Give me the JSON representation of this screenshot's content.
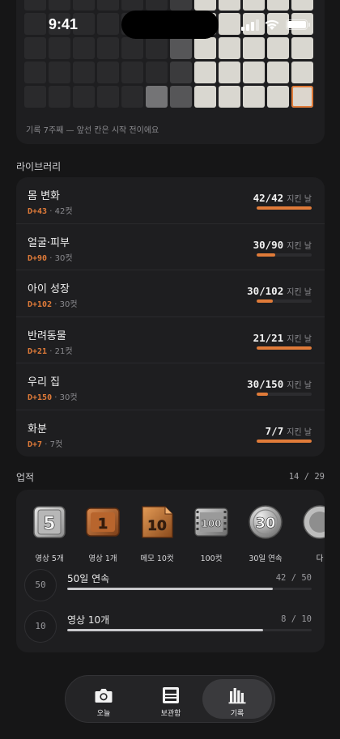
{
  "status_bar": {
    "time": "9:41"
  },
  "grid": {
    "caption": "기록 7주째 — 앞선 칸은 시작 전이에요",
    "rows": [
      [
        "e",
        "e",
        "e",
        "e",
        "e",
        "e",
        "g1",
        "w",
        "w",
        "w",
        "w",
        "w"
      ],
      [
        "e",
        "e",
        "e",
        "e",
        "e",
        "e",
        "g2",
        "w",
        "w",
        "w",
        "w",
        "w"
      ],
      [
        "e",
        "e",
        "e",
        "e",
        "e",
        "e",
        "g2",
        "w",
        "w",
        "w",
        "w",
        "w"
      ],
      [
        "e",
        "e",
        "e",
        "e",
        "e",
        "e",
        "g1",
        "w",
        "w",
        "w",
        "w",
        "w"
      ],
      [
        "e",
        "e",
        "e",
        "e",
        "e",
        "g3",
        "g2",
        "w",
        "w",
        "w",
        "w",
        "today"
      ]
    ]
  },
  "library": {
    "title": "라이브러리",
    "items": [
      {
        "name": "몸 변화",
        "dday": "D+43",
        "shots": "· 42컷",
        "count": "42/42",
        "unit": "지킨 날",
        "progress": 1.0
      },
      {
        "name": "얼굴·피부",
        "dday": "D+90",
        "shots": "· 30컷",
        "count": "30/90",
        "unit": "지킨 날",
        "progress": 0.333
      },
      {
        "name": "아이 성장",
        "dday": "D+102",
        "shots": "· 30컷",
        "count": "30/102",
        "unit": "지킨 날",
        "progress": 0.294
      },
      {
        "name": "반려동물",
        "dday": "D+21",
        "shots": "· 21컷",
        "count": "21/21",
        "unit": "지킨 날",
        "progress": 1.0
      },
      {
        "name": "우리 집",
        "dday": "D+150",
        "shots": "· 30컷",
        "count": "30/150",
        "unit": "지킨 날",
        "progress": 0.2
      },
      {
        "name": "화분",
        "dday": "D+7",
        "shots": "· 7컷",
        "count": "7/7",
        "unit": "지킨 날",
        "progress": 1.0
      }
    ]
  },
  "achievements": {
    "title": "업적",
    "count": "14 / 29",
    "badges": [
      {
        "icon": "silver-5-badge-icon",
        "number": "5",
        "label": "영상 5개"
      },
      {
        "icon": "copper-1-badge-icon",
        "number": "1",
        "label": "영상 1개"
      },
      {
        "icon": "copper-memo-10-badge-icon",
        "number": "10",
        "label": "메모 10컷"
      },
      {
        "icon": "film-100-badge-icon",
        "number": "100",
        "label": "100컷"
      },
      {
        "icon": "coin-30-badge-icon",
        "number": "30",
        "label": "30일 연속"
      },
      {
        "icon": "partial-badge-icon",
        "number": "",
        "label": "다"
      }
    ],
    "progress": [
      {
        "target": "50",
        "name": "50일 연속",
        "value": "42 / 50",
        "progress": 0.84
      },
      {
        "target": "10",
        "name": "영상 10개",
        "value": "8 / 10",
        "progress": 0.8
      }
    ]
  },
  "tabbar": {
    "tabs": [
      {
        "icon": "camera-icon",
        "label": "오늘"
      },
      {
        "icon": "film-archive-icon",
        "label": "보관함"
      },
      {
        "icon": "bar-chart-icon",
        "label": "기록",
        "active": true
      }
    ]
  },
  "colors": {
    "accent": "#e07b39",
    "background": "#161617",
    "card": "#1e1e20"
  }
}
